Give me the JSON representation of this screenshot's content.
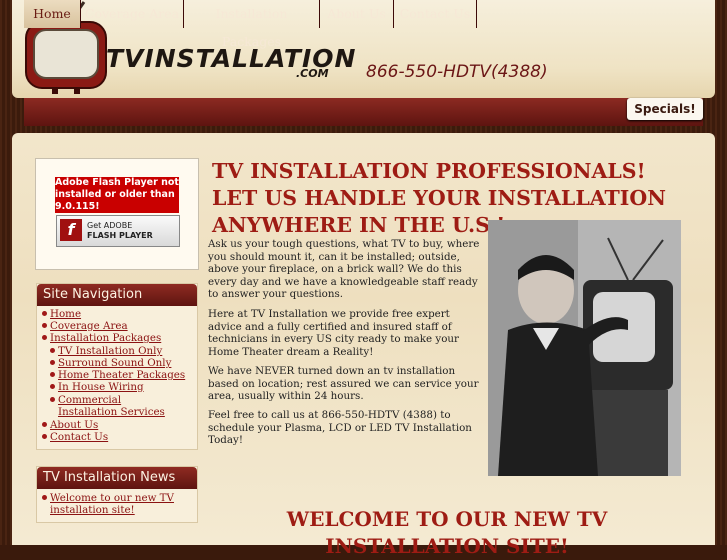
{
  "header": {
    "logo_main": "TVINSTALLATION",
    "logo_com": ".COM",
    "phone": "866-550-HDTV(4388)"
  },
  "nav": {
    "items": [
      "Home",
      "Coverage Area",
      "Installation Packages",
      "About Us",
      "Contact Us"
    ],
    "specials": "Specials!"
  },
  "flash": {
    "message": "Adobe Flash Player not installed or older than 9.0.115!",
    "get_line1": "Get ADOBE",
    "get_line2": "FLASH PLAYER"
  },
  "sidebar": {
    "nav_title": "Site Navigation",
    "links": [
      "Home",
      "Coverage Area",
      "Installation Packages",
      "TV Installation Only",
      "Surround Sound Only",
      "Home Theater Packages",
      "In House Wiring",
      "Commercial Installation Services",
      "About Us",
      "Contact Us"
    ],
    "news_title": "TV Installation News",
    "news_link": "Welcome to our new TV installation site!"
  },
  "main": {
    "title": "TV INSTALLATION PROFESSIONALS! LET US HANDLE YOUR INSTALLATION ANYWHERE IN THE U.S.!",
    "p1": "Ask us your tough questions, what TV to buy, where you should mount it, can it be installed; outside, above your fireplace, on a brick wall? We do this every day and we have a knowledgeable staff ready to answer your questions.",
    "p2": "Here at TV Installation we provide free expert advice and a fully certified and insured staff of technicians in every US city ready to make your Home Theater dream a Reality!",
    "p3": "We have NEVER turned down an tv installation based on location; rest assured we can service your area, usually within 24 hours.",
    "p4": "Feel free to call us at 866-550-HDTV (4388) to schedule your Plasma, LCD or LED TV Installation Today!",
    "welcome": "WELCOME TO OUR NEW TV INSTALLATION SITE!"
  }
}
